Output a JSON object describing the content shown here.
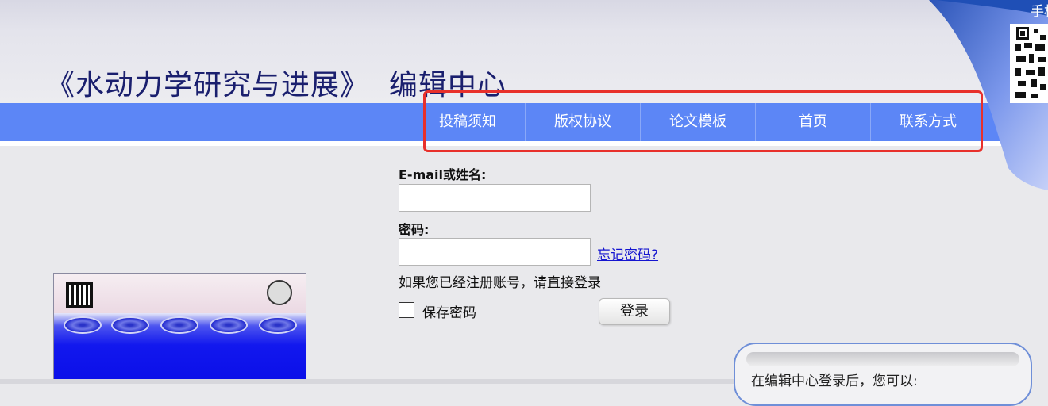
{
  "header": {
    "site_title": "《水动力学研究与进展》  编辑中心",
    "corner_caption": "手机"
  },
  "nav": {
    "items": [
      {
        "label": "投稿须知"
      },
      {
        "label": "版权协议"
      },
      {
        "label": "论文模板"
      },
      {
        "label": "首页"
      },
      {
        "label": "联系方式"
      }
    ]
  },
  "login": {
    "email_label": "E-mail或姓名:",
    "email_value": "",
    "password_label": "密码:",
    "password_value": "",
    "forgot_link": "忘记密码?",
    "hint": "如果您已经注册账号，请直接登录",
    "save_password_label": "保存密码",
    "save_password_checked": false,
    "login_button": "登录"
  },
  "info_panel": {
    "text": "在编辑中心登录后，您可以:"
  },
  "colors": {
    "nav_bar": "#5c86f6",
    "title": "#1a1f6e",
    "highlight": "#e8302b",
    "link": "#1515d0"
  }
}
